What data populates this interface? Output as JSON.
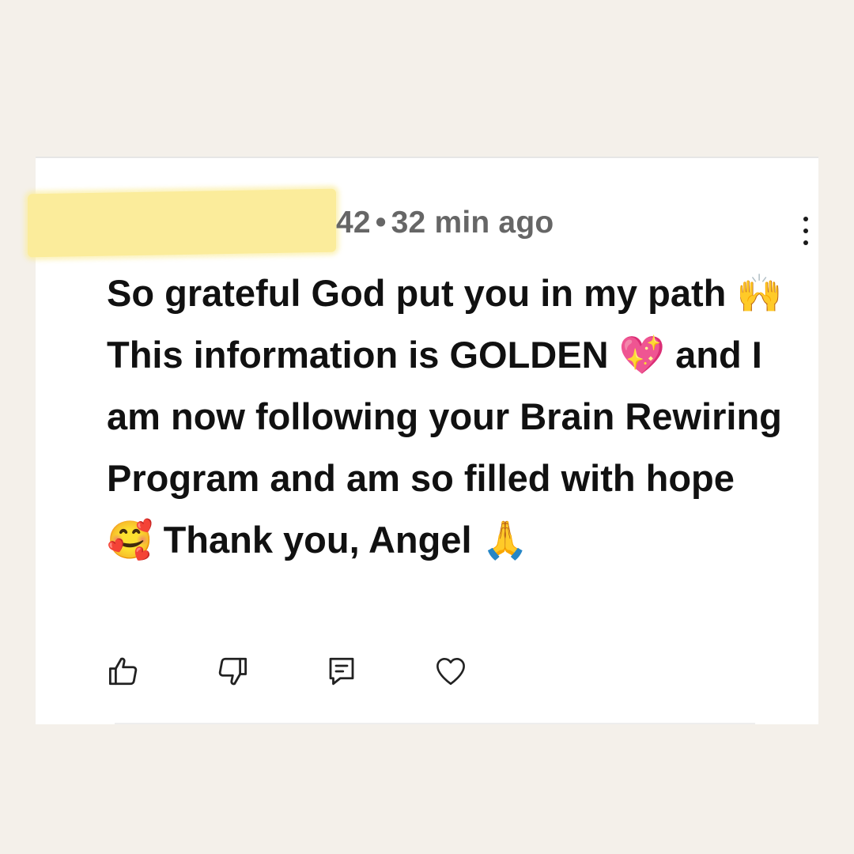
{
  "comment": {
    "author_suffix": "42",
    "separator": "•",
    "timestamp": "32 min ago",
    "text": "So grateful God put you in my path 🙌 This information is GOLDEN 💖 and I am now following your Brain Rewiring Program and am so filled with hope 🥰 Thank you, Angel 🙏"
  },
  "actions": [
    {
      "name": "like",
      "icon": "thumbs-up-icon"
    },
    {
      "name": "dislike",
      "icon": "thumbs-down-icon"
    },
    {
      "name": "reply",
      "icon": "reply-comment-icon"
    },
    {
      "name": "heart",
      "icon": "heart-icon"
    }
  ],
  "menu_icon": "more-vertical-icon",
  "colors": {
    "page_background": "#f4f0ea",
    "card_background": "#ffffff",
    "redaction": "#fbec9b",
    "meta_text": "#666666",
    "body_text": "#111111"
  }
}
